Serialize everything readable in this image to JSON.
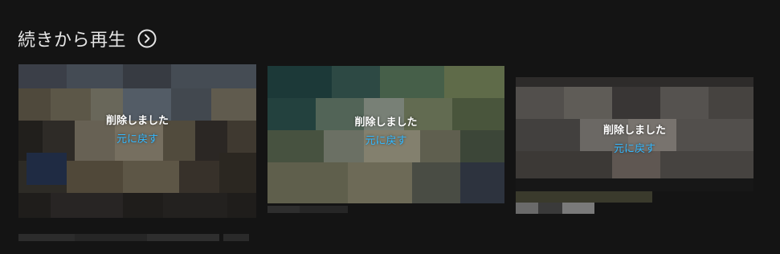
{
  "section": {
    "title": "続きから再生",
    "expand_icon": "chevron-right-circle-icon"
  },
  "cards": [
    {
      "removed_label": "削除しました",
      "undo_label": "元に戻す",
      "thumbnail_state": "pixelated"
    },
    {
      "removed_label": "削除しました",
      "undo_label": "元に戻す",
      "thumbnail_state": "pixelated"
    },
    {
      "removed_label": "削除しました",
      "undo_label": "元に戻す",
      "thumbnail_state": "pixelated"
    }
  ],
  "colors": {
    "background": "#141414",
    "title_text": "#e5e5e5",
    "removed_text": "#ffffff",
    "undo_link": "#33b8ff"
  }
}
